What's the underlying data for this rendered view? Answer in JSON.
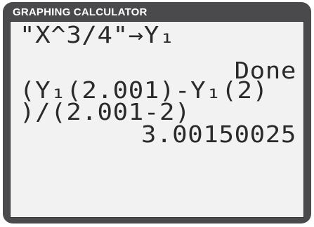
{
  "window": {
    "title": "GRAPHING CALCULATOR"
  },
  "screen": {
    "lines": [
      {
        "text": "\"X^3/4\"→Y₁",
        "align": "left"
      },
      {
        "text": "Done",
        "align": "right"
      },
      {
        "text": "(Y₁(2.001)-Y₁(2)",
        "align": "left"
      },
      {
        "text": ")/(2.001-2)",
        "align": "left"
      },
      {
        "text": "3.00150025",
        "align": "right"
      }
    ]
  },
  "colors": {
    "bezel": "#4a4a4c",
    "screen_bg": "#f2f2f2",
    "text": "#2a2a2a",
    "title_text": "#ffffff"
  }
}
